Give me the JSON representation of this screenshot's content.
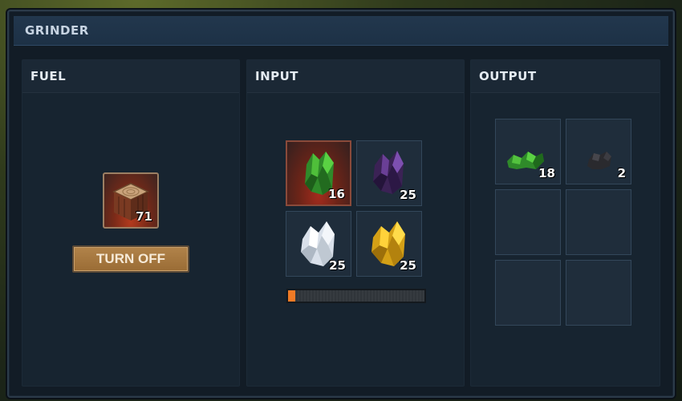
{
  "window": {
    "title": "GRINDER"
  },
  "panels": {
    "fuel": {
      "title": "FUEL"
    },
    "input": {
      "title": "INPUT"
    },
    "output": {
      "title": "OUTPUT"
    }
  },
  "fuel": {
    "item": {
      "icon": "wood-log-icon",
      "count": "71"
    },
    "toggle_label": "TURN OFF"
  },
  "input": {
    "slots": [
      {
        "icon": "green-crystal-icon",
        "count": "16",
        "active": true
      },
      {
        "icon": "purple-crystal-icon",
        "count": "25",
        "active": false
      },
      {
        "icon": "white-crystal-icon",
        "count": "25",
        "active": false
      },
      {
        "icon": "gold-crystal-icon",
        "count": "25",
        "active": false
      }
    ],
    "progress": 0.05
  },
  "output": {
    "slots": [
      {
        "icon": "green-crystal-dust-icon",
        "count": "18"
      },
      {
        "icon": "dark-ore-chunk-icon",
        "count": "2"
      },
      {
        "icon": "",
        "count": ""
      },
      {
        "icon": "",
        "count": ""
      },
      {
        "icon": "",
        "count": ""
      },
      {
        "icon": "",
        "count": ""
      }
    ]
  },
  "colors": {
    "accent_orange": "#f07a25",
    "button_bg": "#a5773f",
    "panel_bg": "#172430",
    "title_bar": "#1f3348"
  }
}
